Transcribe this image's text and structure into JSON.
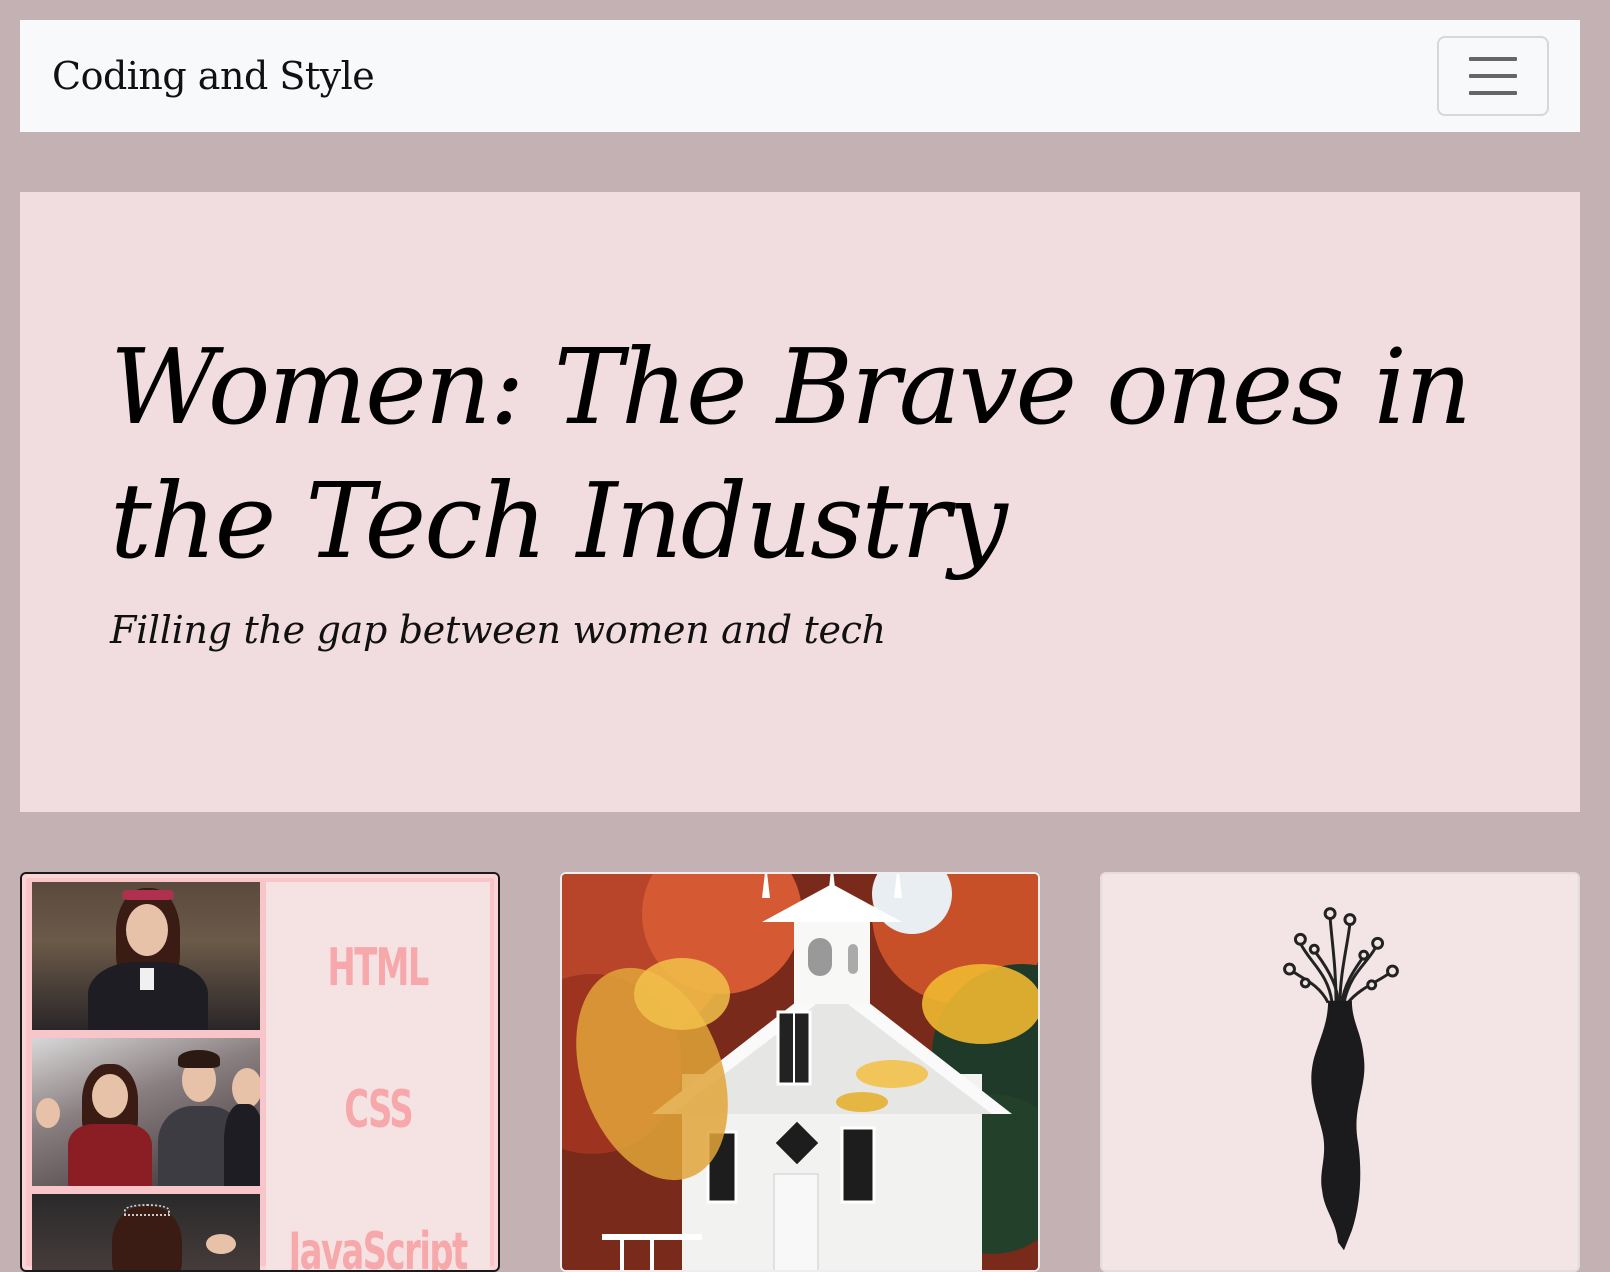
{
  "navbar": {
    "brand": "Coding and Style",
    "toggler_icon": "hamburger-menu-icon"
  },
  "hero": {
    "title": "Women: The Brave ones in the Tech Industry",
    "subtitle": "Filling the gap between women and tech"
  },
  "cards": [
    {
      "image": "collage of drama stills with languages",
      "languages": [
        "HTML",
        "CSS",
        "JavaScript"
      ]
    },
    {
      "image": "white church among autumn trees"
    },
    {
      "image": "silhouette vase with circuit tree"
    }
  ],
  "colors": {
    "page_bg": "#c4b1b3",
    "navbar_bg": "#f8f9fa",
    "hero_bg": "#f1dde0",
    "language_text": "#f6a8ab"
  }
}
